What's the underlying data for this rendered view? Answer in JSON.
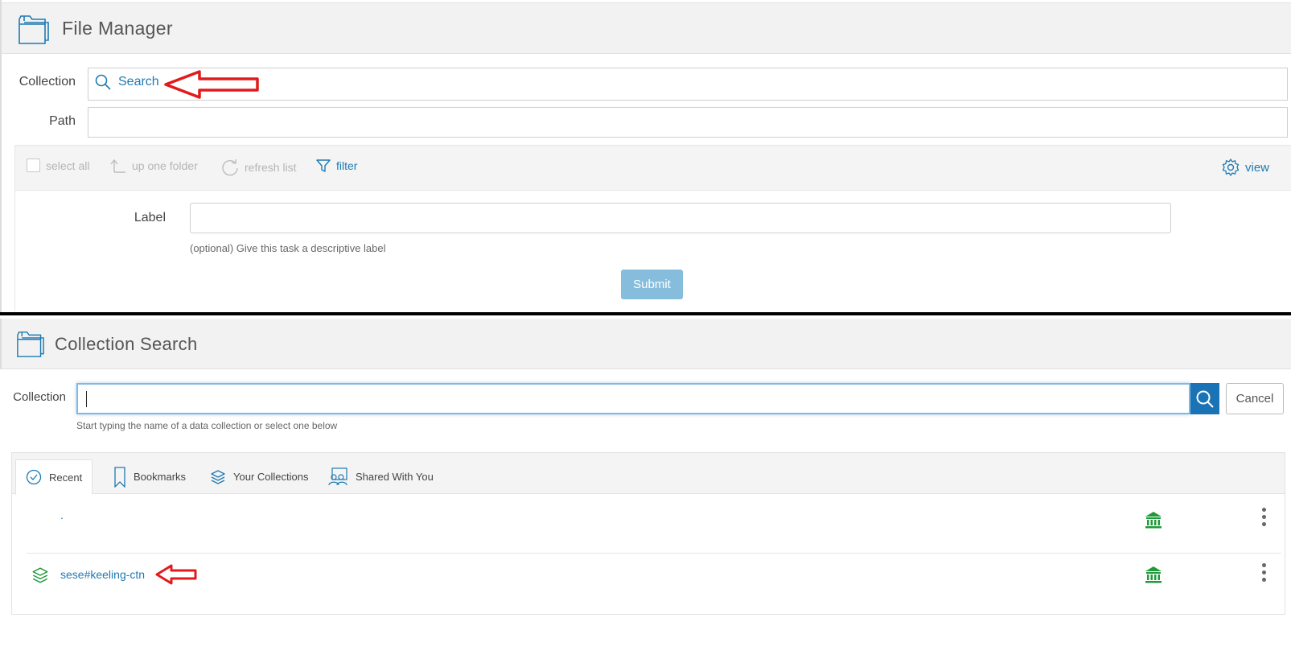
{
  "file_manager": {
    "title": "File Manager",
    "collection_label": "Collection",
    "search_link": "Search",
    "path_label": "Path",
    "path_value": "",
    "toolbar": {
      "select_all": "select all",
      "up_one_folder": "up one folder",
      "refresh_list": "refresh list",
      "filter": "filter",
      "view": "view"
    },
    "label_field": {
      "label": "Label",
      "value": "",
      "help": "(optional) Give this task a descriptive label"
    },
    "submit": "Submit"
  },
  "collection_search": {
    "title": "Collection Search",
    "collection_label": "Collection",
    "input_value": "",
    "help": "Start typing the name of a data collection or select one below",
    "cancel": "Cancel",
    "tabs": [
      {
        "label": "Recent",
        "icon": "clock-icon",
        "active": true
      },
      {
        "label": "Bookmarks",
        "icon": "bookmark-icon",
        "active": false
      },
      {
        "label": "Your Collections",
        "icon": "layers-icon",
        "active": false
      },
      {
        "label": "Shared With You",
        "icon": "shared-users-icon",
        "active": false
      }
    ],
    "rows": [
      {
        "name": "."
      },
      {
        "name": "sese#keeling-ctn"
      }
    ]
  },
  "colors": {
    "link": "#1f7ab2",
    "submit_disabled": "#86bddd",
    "search_button": "#1a73b5",
    "institution_icon": "#1e9a3a",
    "annotation_arrow": "#e11b1b"
  }
}
